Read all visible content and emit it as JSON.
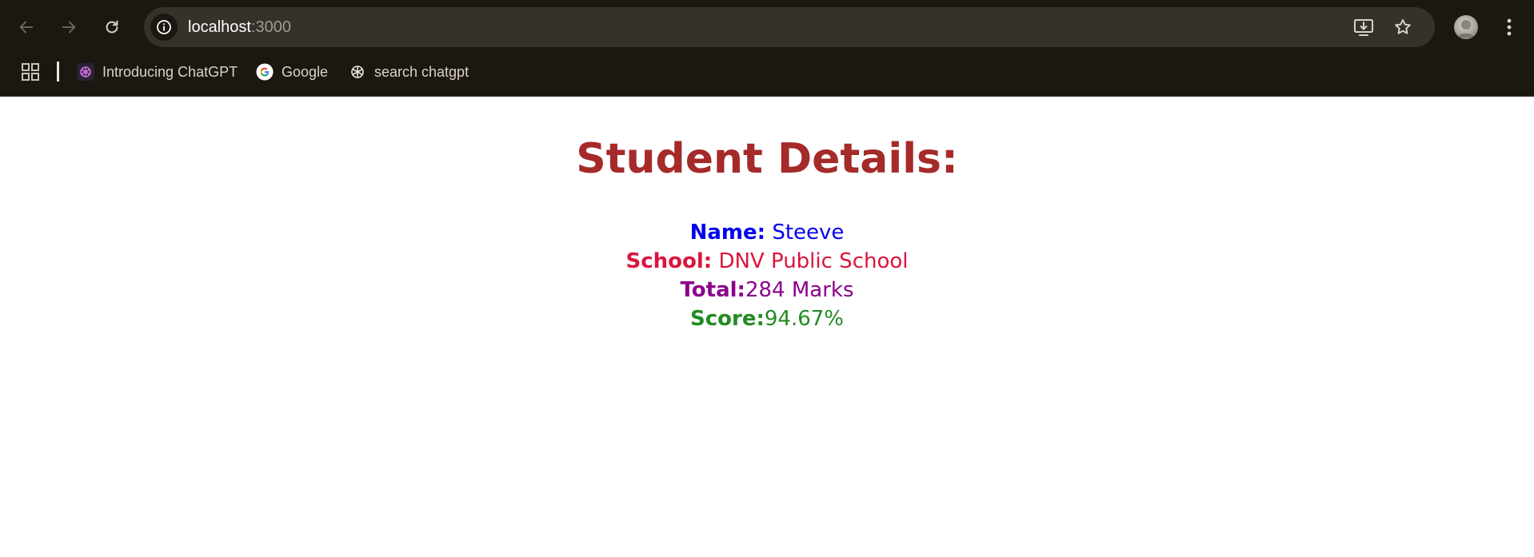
{
  "browser": {
    "url_host": "localhost",
    "url_port": ":3000",
    "bookmarks": [
      {
        "label": "Introducing ChatGPT",
        "icon": "chatgpt-icon"
      },
      {
        "label": "Google",
        "icon": "google-icon"
      },
      {
        "label": "search chatgpt",
        "icon": "openai-icon"
      }
    ]
  },
  "page": {
    "title": "Student Details:",
    "fields": {
      "name": {
        "label": "Name:",
        "value": "Steeve",
        "color": "#0000ee"
      },
      "school": {
        "label": "School:",
        "value": "DNV Public School",
        "color": "#dc143c"
      },
      "total": {
        "label": "Total:",
        "value": "284 Marks",
        "color": "#8b008b"
      },
      "score": {
        "label": "Score:",
        "value": "94.67%",
        "color": "#228b22"
      }
    },
    "title_color": "#a52a2a"
  }
}
